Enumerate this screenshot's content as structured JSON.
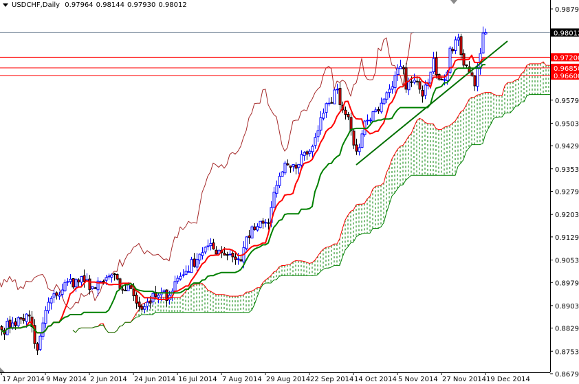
{
  "header": {
    "symbol": "USDCHF,Daily",
    "open": "0.97964",
    "high": "0.98144",
    "low": "0.97930",
    "close": "0.98012"
  },
  "chart_data": {
    "type": "candlestick",
    "title": "USDCHF,Daily",
    "indicators": [
      "Ichimoku Kinko Hyo (Tenkan-sen, Kijun-sen, Senkou Span A/B cloud, Chikou Span)"
    ],
    "ylim": [
      0.866,
      0.9907
    ],
    "y_ticks": [
      "0.98790",
      "0.95790",
      "0.95030",
      "0.94290",
      "0.93530",
      "0.92790",
      "0.92030",
      "0.91290",
      "0.90530",
      "0.89790",
      "0.89030",
      "0.88290",
      "0.87530",
      "0.86790"
    ],
    "x_ticks": [
      {
        "bar": 0,
        "label": "17 Apr 2014"
      },
      {
        "bar": 16,
        "label": "9 May 2014"
      },
      {
        "bar": 32,
        "label": "2 Jun 2014"
      },
      {
        "bar": 48,
        "label": "24 Jun 2014"
      },
      {
        "bar": 64,
        "label": "16 Jul 2014"
      },
      {
        "bar": 80,
        "label": "7 Aug 2014"
      },
      {
        "bar": 96,
        "label": "29 Aug 2014"
      },
      {
        "bar": 112,
        "label": "22 Sep 2014"
      },
      {
        "bar": 128,
        "label": "14 Oct 2014"
      },
      {
        "bar": 144,
        "label": "5 Nov 2014"
      },
      {
        "bar": 160,
        "label": "27 Nov 2014"
      },
      {
        "bar": 176,
        "label": "19 Dec 2014"
      }
    ],
    "close_path": [
      [
        0,
        0.8824
      ],
      [
        4,
        0.8846
      ],
      [
        10,
        0.8869
      ],
      [
        12,
        0.8778
      ],
      [
        13,
        0.8756
      ],
      [
        15,
        0.8846
      ],
      [
        17,
        0.8914
      ],
      [
        20,
        0.8937
      ],
      [
        24,
        0.8982
      ],
      [
        30,
        0.8982
      ],
      [
        34,
        0.8959
      ],
      [
        37,
        0.8982
      ],
      [
        40,
        0.9004
      ],
      [
        43,
        0.8959
      ],
      [
        47,
        0.8959
      ],
      [
        51,
        0.8891
      ],
      [
        53,
        0.8914
      ],
      [
        57,
        0.8937
      ],
      [
        61,
        0.8937
      ],
      [
        63,
        0.8982
      ],
      [
        67,
        0.9016
      ],
      [
        72,
        0.9072
      ],
      [
        74,
        0.9095
      ],
      [
        79,
        0.9084
      ],
      [
        83,
        0.9072
      ],
      [
        87,
        0.905
      ],
      [
        89,
        0.9129
      ],
      [
        93,
        0.9163
      ],
      [
        97,
        0.9174
      ],
      [
        99,
        0.9276
      ],
      [
        102,
        0.9343
      ],
      [
        104,
        0.9366
      ],
      [
        107,
        0.9355
      ],
      [
        109,
        0.94
      ],
      [
        112,
        0.9411
      ],
      [
        114,
        0.9456
      ],
      [
        117,
        0.9536
      ],
      [
        119,
        0.9569
      ],
      [
        122,
        0.9615
      ],
      [
        124,
        0.9547
      ],
      [
        126,
        0.9524
      ],
      [
        127,
        0.9479
      ],
      [
        129,
        0.9411
      ],
      [
        131,
        0.9468
      ],
      [
        133,
        0.9513
      ],
      [
        136,
        0.9547
      ],
      [
        138,
        0.9569
      ],
      [
        141,
        0.9615
      ],
      [
        143,
        0.966
      ],
      [
        146,
        0.9682
      ],
      [
        147,
        0.9615
      ],
      [
        149,
        0.9637
      ],
      [
        152,
        0.9615
      ],
      [
        153,
        0.9592
      ],
      [
        156,
        0.9671
      ],
      [
        157,
        0.9716
      ],
      [
        159,
        0.9648
      ],
      [
        162,
        0.9671
      ],
      [
        163,
        0.975
      ],
      [
        166,
        0.9784
      ],
      [
        168,
        0.9694
      ],
      [
        171,
        0.966
      ],
      [
        172,
        0.9626
      ],
      [
        174,
        0.9732
      ],
      [
        175,
        0.98
      ],
      [
        176,
        0.98012
      ]
    ],
    "last_bar": {
      "open": 0.97964,
      "high": 0.98144,
      "low": 0.9793,
      "close": 0.98012
    },
    "horizontal_levels": [
      {
        "price": 0.98012,
        "label": "0.98012",
        "color": "#000000",
        "line": "#8090a0"
      },
      {
        "price": 0.972,
        "label": "0.97200",
        "color": "#ff0000",
        "line": "#ff0000"
      },
      {
        "price": 0.9685,
        "label": "0.96850",
        "color": "#ff0000",
        "line": "#ff0000"
      },
      {
        "price": 0.966,
        "label": "0.96600",
        "color": "#ff0000",
        "line": "#ff0000"
      }
    ],
    "trendline": [
      [
        129,
        0.9366
      ],
      [
        184,
        0.9773
      ]
    ],
    "colors": {
      "bull": "#0000ff",
      "bear_body": "#ff0000",
      "bear_wick": "#000000",
      "tenkan": "#ff0000",
      "kijun": "#008000",
      "chikou": "#a52a2a",
      "span_a": "#ff0000",
      "span_b": "#008000",
      "trendline": "#007000"
    }
  }
}
